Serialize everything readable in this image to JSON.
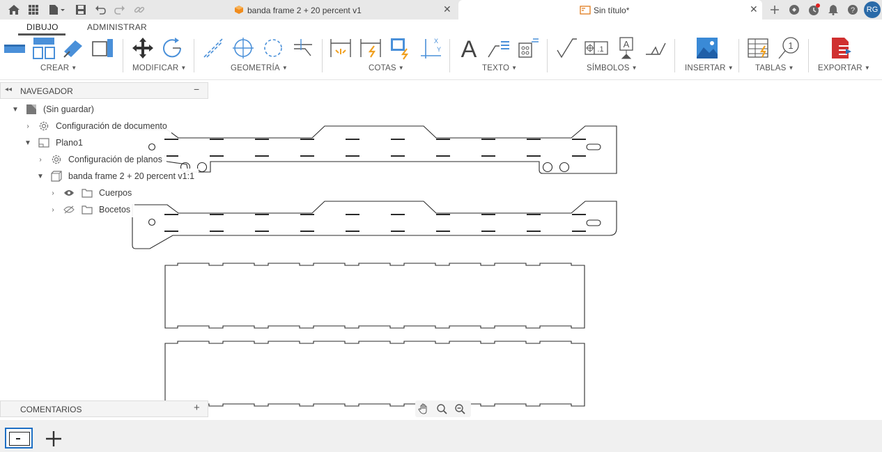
{
  "window_tabs": [
    {
      "label": "banda frame 2 + 20 percent v1",
      "active": false,
      "icon": "cube-icon"
    },
    {
      "label": "Sin título*",
      "active": true,
      "icon": "drawing-icon"
    }
  ],
  "quick_access": [
    "home-icon",
    "grid-apps-icon",
    "file-icon",
    "save-icon",
    "undo-icon",
    "redo-icon",
    "link-icon"
  ],
  "right_icons": [
    "new-tab-plus-icon",
    "extensions-icon",
    "job-status-icon",
    "notifications-icon",
    "help-icon"
  ],
  "user": {
    "initials": "RG",
    "avatar_color": "#2a6aa8"
  },
  "ribbon": {
    "tabs": [
      {
        "label": "DIBUJO",
        "active": true
      },
      {
        "label": "ADMINISTRAR",
        "active": false
      }
    ],
    "groups": [
      "CREAR",
      "MODIFICAR",
      "GEOMETRÍA",
      "COTAS",
      "TEXTO",
      "SÍMBOLOS",
      "INSERTAR",
      "TABLAS",
      "EXPORTAR"
    ]
  },
  "browser": {
    "title": "NAVEGADOR",
    "nodes": [
      {
        "label": "(Sin guardar)",
        "expanded": true
      },
      {
        "label": "Configuración de documento",
        "expanded": false
      },
      {
        "label": "Plano1",
        "expanded": true
      },
      {
        "label": "Configuración de planos",
        "expanded": false
      },
      {
        "label": "banda frame 2 + 20 percent v1:1",
        "expanded": true
      },
      {
        "label": "Cuerpos",
        "visible": true
      },
      {
        "label": "Bocetos",
        "visible": false
      }
    ]
  },
  "comments": {
    "title": "COMENTARIOS"
  },
  "navbar": [
    "pan-hand-icon",
    "zoom-window-icon",
    "zoom-out-icon"
  ],
  "colors": {
    "accent": "#1e6fc4",
    "toolbar_bg": "#e8e8e8",
    "lines": "#222222"
  }
}
